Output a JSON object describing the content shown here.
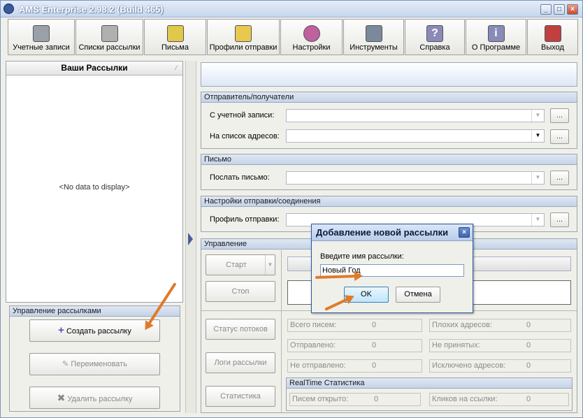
{
  "window": {
    "title": "AMS Enterprise 2.98.2 (Build 465)",
    "min": "_",
    "max": "□",
    "close": "×"
  },
  "toolbar": [
    {
      "label": "Учетные записи",
      "icon": "accounts-icon",
      "color": "#9aa0a8"
    },
    {
      "label": "Списки рассылки",
      "icon": "mailing-lists-icon",
      "color": "#b0b0b0"
    },
    {
      "label": "Письма",
      "icon": "letters-icon",
      "color": "#e0c84a"
    },
    {
      "label": "Профили отправки",
      "icon": "send-profile-icon",
      "color": "#e8c850"
    },
    {
      "label": "Настройки",
      "icon": "settings-icon",
      "color": "#c060a0"
    },
    {
      "label": "Инструменты",
      "icon": "tools-icon",
      "color": "#7a8a9a"
    },
    {
      "label": "Справка",
      "icon": "help-icon",
      "color": "#8a8ab8"
    },
    {
      "label": "О Программе",
      "icon": "about-icon",
      "color": "#8a8ab8"
    },
    {
      "label": "Выход",
      "icon": "exit-icon",
      "color": "#c04040"
    }
  ],
  "left": {
    "header": "Ваши Рассылки",
    "sort": "⁄",
    "empty": "<No data to display>",
    "mgmt_title": "Управление рассылками",
    "create": "Создать рассылку",
    "rename": "Переименовать",
    "delete": "Удалить рассылку"
  },
  "sender": {
    "title": "Отправитель/получатели",
    "from_label": "С учетной записи:",
    "to_label": "На список адресов:",
    "dots": "..."
  },
  "letter": {
    "title": "Письмо",
    "send_label": "Послать письмо:"
  },
  "conn": {
    "title": "Настройки отправки/соединения",
    "profile_label": "Профиль отправки:"
  },
  "control": {
    "title": "Управление",
    "start": "Старт",
    "stop": "Стоп",
    "thread_status": "Статус потоков",
    "logs": "Логи рассылки",
    "stats": "Статистика"
  },
  "stats": [
    {
      "label": "Всего писем:",
      "value": "0"
    },
    {
      "label": "Плохих адресов:",
      "value": "0"
    },
    {
      "label": "Отправлено:",
      "value": "0"
    },
    {
      "label": "Не принятых:",
      "value": "0"
    },
    {
      "label": "Не отправлено:",
      "value": "0"
    },
    {
      "label": "Исключено адресов:",
      "value": "0"
    }
  ],
  "realtime": {
    "title": "RealTime Статистика",
    "opened_label": "Писем открыто:",
    "opened": "0",
    "clicks_label": "Кликов на ссылки:",
    "clicks": "0"
  },
  "dialog": {
    "title": "Добавление новой рассылки",
    "close": "×",
    "prompt": "Введите имя рассылки:",
    "value": "Новый Год",
    "ok": "OK",
    "cancel": "Отмена"
  },
  "colors": {
    "accent": "#e07a2a",
    "group_header": "#c5d3e8"
  }
}
